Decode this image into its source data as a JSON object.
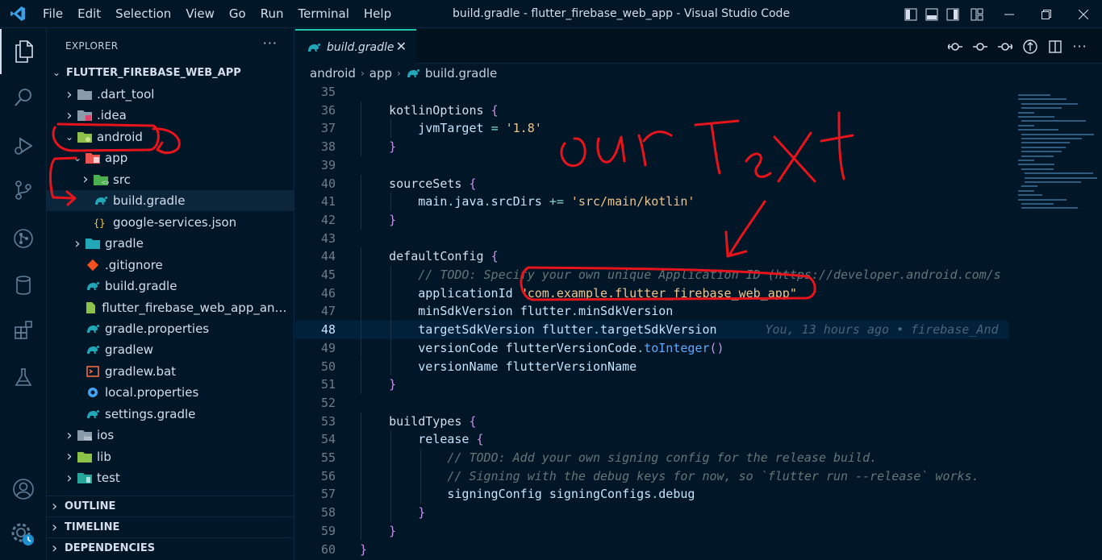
{
  "titlebar": {
    "menu": [
      "File",
      "Edit",
      "Selection",
      "View",
      "Go",
      "Run",
      "Terminal",
      "Help"
    ],
    "title": "build.gradle - flutter_firebase_web_app - Visual Studio Code"
  },
  "explorer": {
    "header": "EXPLORER",
    "project": "FLUTTER_FIREBASE_WEB_APP",
    "items": [
      {
        "label": ".dart_tool",
        "icon": "folder-icon",
        "indent": 0,
        "chevron": "right"
      },
      {
        "label": ".idea",
        "icon": "folder-idea-icon",
        "indent": 0,
        "chevron": "right"
      },
      {
        "label": "android",
        "icon": "folder-android-icon",
        "indent": 0,
        "chevron": "down"
      },
      {
        "label": "app",
        "icon": "folder-app-icon",
        "indent": 1,
        "chevron": "down"
      },
      {
        "label": "src",
        "icon": "folder-src-icon",
        "indent": 2,
        "chevron": "right"
      },
      {
        "label": "build.gradle",
        "icon": "gradle-file-icon",
        "indent": 2,
        "chevron": "none",
        "selected": true
      },
      {
        "label": "google-services.json",
        "icon": "json-file-icon",
        "indent": 2,
        "chevron": "none"
      },
      {
        "label": "gradle",
        "icon": "folder-gradle-icon",
        "indent": 1,
        "chevron": "right"
      },
      {
        "label": ".gitignore",
        "icon": "git-file-icon",
        "indent": 1,
        "chevron": "none"
      },
      {
        "label": "build.gradle",
        "icon": "gradle-file-icon",
        "indent": 1,
        "chevron": "none"
      },
      {
        "label": "flutter_firebase_web_app_andro...",
        "icon": "iml-file-icon",
        "indent": 1,
        "chevron": "none"
      },
      {
        "label": "gradle.properties",
        "icon": "gradle-file-icon",
        "indent": 1,
        "chevron": "none"
      },
      {
        "label": "gradlew",
        "icon": "gradle-file-icon",
        "indent": 1,
        "chevron": "none"
      },
      {
        "label": "gradlew.bat",
        "icon": "bat-file-icon",
        "indent": 1,
        "chevron": "none"
      },
      {
        "label": "local.properties",
        "icon": "gear-file-icon",
        "indent": 1,
        "chevron": "none"
      },
      {
        "label": "settings.gradle",
        "icon": "gradle-file-icon",
        "indent": 1,
        "chevron": "none"
      },
      {
        "label": "ios",
        "icon": "folder-ios-icon",
        "indent": 0,
        "chevron": "right"
      },
      {
        "label": "lib",
        "icon": "folder-lib-icon",
        "indent": 0,
        "chevron": "right"
      },
      {
        "label": "test",
        "icon": "folder-test-icon",
        "indent": 0,
        "chevron": "right"
      }
    ],
    "sections": [
      "OUTLINE",
      "TIMELINE",
      "DEPENDENCIES"
    ]
  },
  "editor": {
    "tab": "build.gradle",
    "breadcrumb": [
      "android",
      "app",
      "build.gradle"
    ],
    "current_line": 48,
    "blame": "You, 13 hours ago • firebase_And",
    "lines": [
      {
        "n": 35,
        "t": []
      },
      {
        "n": 36,
        "t": [
          [
            "    kotlinOptions ",
            "k"
          ],
          [
            "{",
            "p"
          ]
        ]
      },
      {
        "n": 37,
        "t": [
          [
            "        jvmTarget ",
            "id"
          ],
          [
            "= ",
            "o"
          ],
          [
            "'1.8'",
            "s"
          ]
        ]
      },
      {
        "n": 38,
        "t": [
          [
            "    ",
            "k"
          ],
          [
            "}",
            "p"
          ]
        ]
      },
      {
        "n": 39,
        "t": []
      },
      {
        "n": 40,
        "t": [
          [
            "    sourceSets ",
            "k"
          ],
          [
            "{",
            "p"
          ]
        ]
      },
      {
        "n": 41,
        "t": [
          [
            "        main",
            "id"
          ],
          [
            ".",
            "o"
          ],
          [
            "java",
            "id"
          ],
          [
            ".",
            "o"
          ],
          [
            "srcDirs ",
            "id"
          ],
          [
            "+= ",
            "o"
          ],
          [
            "'src/main/kotlin'",
            "s"
          ]
        ]
      },
      {
        "n": 42,
        "t": [
          [
            "    ",
            "k"
          ],
          [
            "}",
            "p"
          ]
        ]
      },
      {
        "n": 43,
        "t": []
      },
      {
        "n": 44,
        "t": [
          [
            "    defaultConfig ",
            "k"
          ],
          [
            "{",
            "p"
          ]
        ]
      },
      {
        "n": 45,
        "t": [
          [
            "        // TODO: Specify your own unique Application ID (https://developer.android.com/s",
            "c"
          ]
        ]
      },
      {
        "n": 46,
        "t": [
          [
            "        applicationId ",
            "id"
          ],
          [
            "\"com.example.flutter_firebase_web_app\"",
            "s"
          ]
        ]
      },
      {
        "n": 47,
        "t": [
          [
            "        minSdkVersion ",
            "id"
          ],
          [
            "flutter",
            "id"
          ],
          [
            ".",
            "o"
          ],
          [
            "minSdkVersion",
            "id"
          ]
        ]
      },
      {
        "n": 48,
        "t": [
          [
            "        targetSdkVersion ",
            "id"
          ],
          [
            "flutter",
            "id"
          ],
          [
            ".",
            "o"
          ],
          [
            "targetSdkVersion",
            "id"
          ]
        ]
      },
      {
        "n": 49,
        "t": [
          [
            "        versionCode ",
            "id"
          ],
          [
            "flutterVersionCode",
            "id"
          ],
          [
            ".",
            "o"
          ],
          [
            "toInteger",
            "bl"
          ],
          [
            "()",
            "p"
          ]
        ]
      },
      {
        "n": 50,
        "t": [
          [
            "        versionName ",
            "id"
          ],
          [
            "flutterVersionName",
            "id"
          ]
        ]
      },
      {
        "n": 51,
        "t": [
          [
            "    ",
            "k"
          ],
          [
            "}",
            "p"
          ]
        ]
      },
      {
        "n": 52,
        "t": []
      },
      {
        "n": 53,
        "t": [
          [
            "    buildTypes ",
            "k"
          ],
          [
            "{",
            "p"
          ]
        ]
      },
      {
        "n": 54,
        "t": [
          [
            "        release ",
            "id"
          ],
          [
            "{",
            "p"
          ]
        ]
      },
      {
        "n": 55,
        "t": [
          [
            "            // TODO: Add your own signing config for the release build.",
            "c"
          ]
        ]
      },
      {
        "n": 56,
        "t": [
          [
            "            // Signing with the debug keys for now, so `flutter run --release` works.",
            "c"
          ]
        ]
      },
      {
        "n": 57,
        "t": [
          [
            "            signingConfig ",
            "id"
          ],
          [
            "signingConfigs",
            "id"
          ],
          [
            ".",
            "o"
          ],
          [
            "debug",
            "id"
          ]
        ]
      },
      {
        "n": 58,
        "t": [
          [
            "        ",
            "k"
          ],
          [
            "}",
            "p"
          ]
        ]
      },
      {
        "n": 59,
        "t": [
          [
            "    ",
            "k"
          ],
          [
            "}",
            "p"
          ]
        ]
      },
      {
        "n": 60,
        "t": [
          [
            "}",
            "p"
          ]
        ]
      }
    ]
  },
  "colors": {
    "background": "#011627",
    "accent": "#21c7a8",
    "annotation": "#e8141c"
  }
}
